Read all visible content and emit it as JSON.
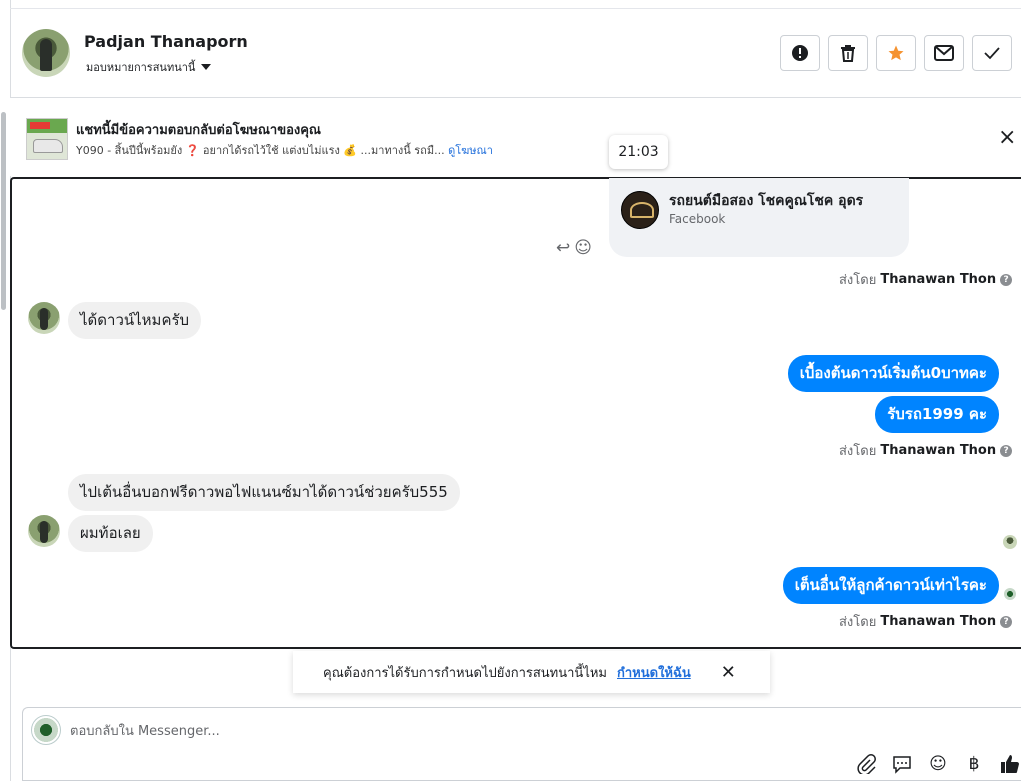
{
  "header": {
    "contact_name": "Padjan Thanaporn",
    "assign_label": "มอบหมายการสนทนานี้",
    "actions": [
      "report-icon",
      "trash-icon",
      "star-icon",
      "mail-icon",
      "check-icon"
    ]
  },
  "ad": {
    "title": "แชทนี้มีข้อความตอบกลับต่อโฆษณาของคุณ",
    "subtitle": "Y090 - สิ้นปีนี้พร้อมยัง ❓ อยากได้รถไว้ใช้ แต่งบไม่แรง 💰 ...มาทางนี้ รถมื...",
    "link": "ดูโฆษณา"
  },
  "tooltip": "21:03",
  "shared_card": {
    "name": "รถยนต์มือสอง โชคคูณโชค อุดร",
    "source": "Facebook"
  },
  "sent_by_label": "ส่งโดย",
  "sent_by_name": "Thanawan Thon",
  "messages": {
    "in1": "ได้ดาวน์ไหมครับ",
    "out1": "เบื้องต้นดาวน์เริ่มต้น0บาทคะ",
    "out2": "รับรถ1999 คะ",
    "in2": "ไปเต้นอื่นบอกฟรีดาวพอไฟแนนซ์มาได้ดาวน์ช่วยครับ555",
    "in3": "ผมท้อเลย",
    "out3": "เต็นอื่นให้ลูกค้าดาวน์เท่าไรคะ"
  },
  "suggestion": {
    "text": "คุณต้องการได้รับการกำหนดไปยังการสนทนานี้ไหม",
    "link": "กำหนดให้ฉัน"
  },
  "composer": {
    "placeholder": "ตอบกลับใน Messenger...",
    "icons": [
      "attach-icon",
      "chat-icon",
      "emoji-icon",
      "baht-icon",
      "like-icon"
    ]
  },
  "colors": {
    "outgoing": "#0084ff",
    "incoming": "#f0f0f0",
    "link": "#216fdb"
  }
}
